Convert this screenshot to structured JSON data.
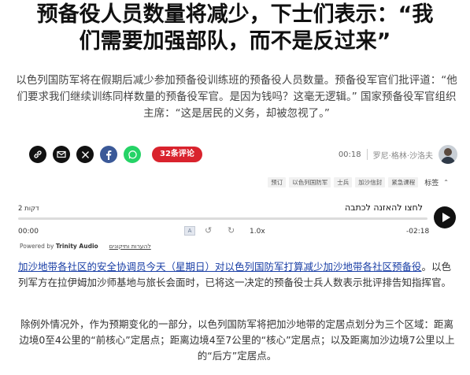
{
  "article": {
    "headline_line1": "预备役人员数量将减少，下士们表示：“我",
    "headline_line2": "们需要加强部队，而不是反过来”",
    "subhead": "以色列国防军将在假期后减少参加预备役训练班的预备役人员数量。预备役军官们批评道：“他们要求我们继续训练同样数量的预备役军官。是因为钱吗？这毫无逻辑。” 国家预备役军官组织主席：“这是居民的义务，却被忽视了。”"
  },
  "share": {
    "icons": [
      "link-icon",
      "email-icon",
      "x-icon",
      "facebook-icon",
      "whatsapp-icon"
    ],
    "comments_label": "32条评论",
    "comments_color": "#d9232d"
  },
  "byline": {
    "time": "00:18",
    "author": "罗尼·格林·沙洛夫"
  },
  "tags": {
    "items": [
      "预订",
      "以色列国防军",
      "士兵",
      "加沙信封",
      "紧急课程"
    ],
    "label": "标签"
  },
  "audio": {
    "duration_label": "2 דקות",
    "listen_label": "לחצו להאזנה לכתבה",
    "current_time": "00:00",
    "end_time": "-02:18",
    "speed": "1.0x",
    "progress": 0,
    "powered_prefix": "Powered by",
    "powered_brand": "Trinity Audio",
    "feedback_label": "להערות ותיקונים"
  },
  "body": {
    "p1_link": "加沙地带各社区的安全协调员今天（星期日）对以色列国防军打算减少加沙地带各社区预备役",
    "p1_rest": "。以色列军方在拉伊姆加沙师基地与旅长会面时，已将这一决定的预备役士兵人数表示批评排告知指挥官。",
    "p2": "除例外情况外，作为预期变化的一部分，以色列国防军将把加沙地带的定居点划分为三个区域：距离边境0至4公里的“前核心”定居点；距离边境4至7公里的“核心”定居点；以及距离加沙边境7公里以上的“后方”定居点。"
  }
}
